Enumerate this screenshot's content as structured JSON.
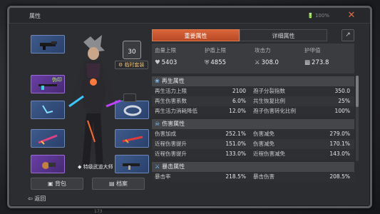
{
  "window": {
    "title": "属性",
    "battery": "100%",
    "close_icon": "close-icon"
  },
  "left": {
    "level": "30",
    "temp_suit": "临时套装",
    "slot_tag": "伪印",
    "title_name": "特级武道大师",
    "bag_label": "背包",
    "archive_label": "档案",
    "back_label": "返回"
  },
  "tabs": [
    {
      "label": "重要属性",
      "active": true
    },
    {
      "label": "详细属性",
      "active": false
    }
  ],
  "summary": [
    {
      "label": "血量上限",
      "value": "5403",
      "icon": "heart-icon"
    },
    {
      "label": "护盾上限",
      "value": "4855",
      "icon": "shield-icon"
    },
    {
      "label": "攻击力",
      "value": "308.0",
      "icon": "attack-icon"
    },
    {
      "label": "护甲值",
      "value": "273.8",
      "icon": "armor-icon"
    }
  ],
  "sections": [
    {
      "title": "再生属性",
      "rows": [
        {
          "n1": "再生活力上限",
          "v1": "2100",
          "n2": "孢子分裂指数",
          "v2": "350.0"
        },
        {
          "n1": "再生伤害系数",
          "v1": "6.0%",
          "n2": "共生恢复比例",
          "v2": "25%"
        },
        {
          "n1": "再生活力消耗降低",
          "v1": "12.0%",
          "n2": "孢子伤害转化比例",
          "v2": "100%"
        }
      ]
    },
    {
      "title": "伤害属性",
      "rows": [
        {
          "n1": "伤害加成",
          "v1": "252.1%",
          "n2": "伤害减免",
          "v2": "279.0%"
        },
        {
          "n1": "近程伤害提升",
          "v1": "151.0%",
          "n2": "伤害减免",
          "v2": "170.1%"
        },
        {
          "n1": "近程伤害提升",
          "v1": "133.0%",
          "n2": "近程伤害减免",
          "v2": "143.0%"
        }
      ]
    },
    {
      "title": "暴击属性",
      "rows": [
        {
          "n1": "暴击率",
          "v1": "218.5%",
          "n2": "暴击伤害",
          "v2": "208.5%"
        }
      ]
    }
  ],
  "footer": "173"
}
